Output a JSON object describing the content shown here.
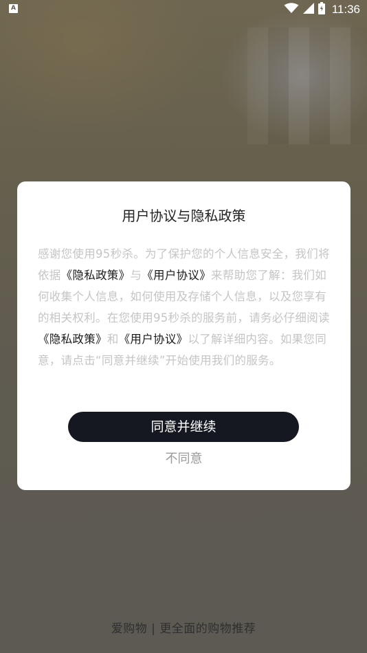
{
  "status_bar": {
    "left_icon_letter": "A",
    "time": "11:36",
    "icons": [
      "wifi-icon",
      "signal-icon",
      "battery-icon"
    ]
  },
  "dialog": {
    "title": "用户协议与隐私政策",
    "body_parts": [
      {
        "text": "感谢您使用95秒杀。为了保护您的个人信息安全，我们将依据",
        "link": false
      },
      {
        "text": "《隐私政策》",
        "link": true
      },
      {
        "text": "与",
        "link": false
      },
      {
        "text": "《用户协议》",
        "link": true
      },
      {
        "text": "来帮助您了解：我们如何收集个人信息，如何使用及存储个人信息，以及您享有的相关权利。在您使用95秒杀的服务前，请务必仔细阅读",
        "link": false
      },
      {
        "text": "《隐私政策》",
        "link": true
      },
      {
        "text": "和",
        "link": false
      },
      {
        "text": "《用户协议》",
        "link": true
      },
      {
        "text": "以了解详细内容。如果您同意，请点击“同意并继续”开始使用我们的服务。",
        "link": false
      }
    ],
    "agree_label": "同意并继续",
    "disagree_label": "不同意"
  },
  "footer": {
    "slogan": "爱购物 | 更全面的购物推荐"
  },
  "colors": {
    "overlay": "#5f5b52",
    "button_dark": "#161821",
    "body_text": "#c5c5c5",
    "link_text": "#1a1a1a"
  }
}
